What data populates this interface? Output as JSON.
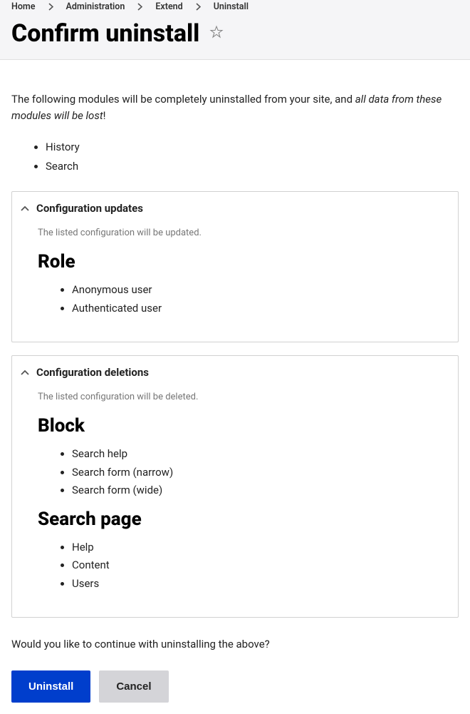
{
  "breadcrumb": {
    "items": [
      {
        "label": "Home"
      },
      {
        "label": "Administration"
      },
      {
        "label": "Extend"
      },
      {
        "label": "Uninstall"
      }
    ]
  },
  "page": {
    "title": "Confirm uninstall"
  },
  "intro": {
    "pre": "The following modules will be completely uninstalled from your site, and ",
    "italic": "all data from these modules will be lost",
    "post": "!"
  },
  "modules": [
    "History",
    "Search"
  ],
  "panels": {
    "updates": {
      "title": "Configuration updates",
      "desc": "The listed configuration will be updated.",
      "sections": [
        {
          "heading": "Role",
          "items": [
            "Anonymous user",
            "Authenticated user"
          ]
        }
      ]
    },
    "deletions": {
      "title": "Configuration deletions",
      "desc": "The listed configuration will be deleted.",
      "sections": [
        {
          "heading": "Block",
          "items": [
            "Search help",
            "Search form (narrow)",
            "Search form (wide)"
          ]
        },
        {
          "heading": "Search page",
          "items": [
            "Help",
            "Content",
            "Users"
          ]
        }
      ]
    }
  },
  "confirm": {
    "text": "Would you like to continue with uninstalling the above?"
  },
  "buttons": {
    "primary": "Uninstall",
    "secondary": "Cancel"
  }
}
